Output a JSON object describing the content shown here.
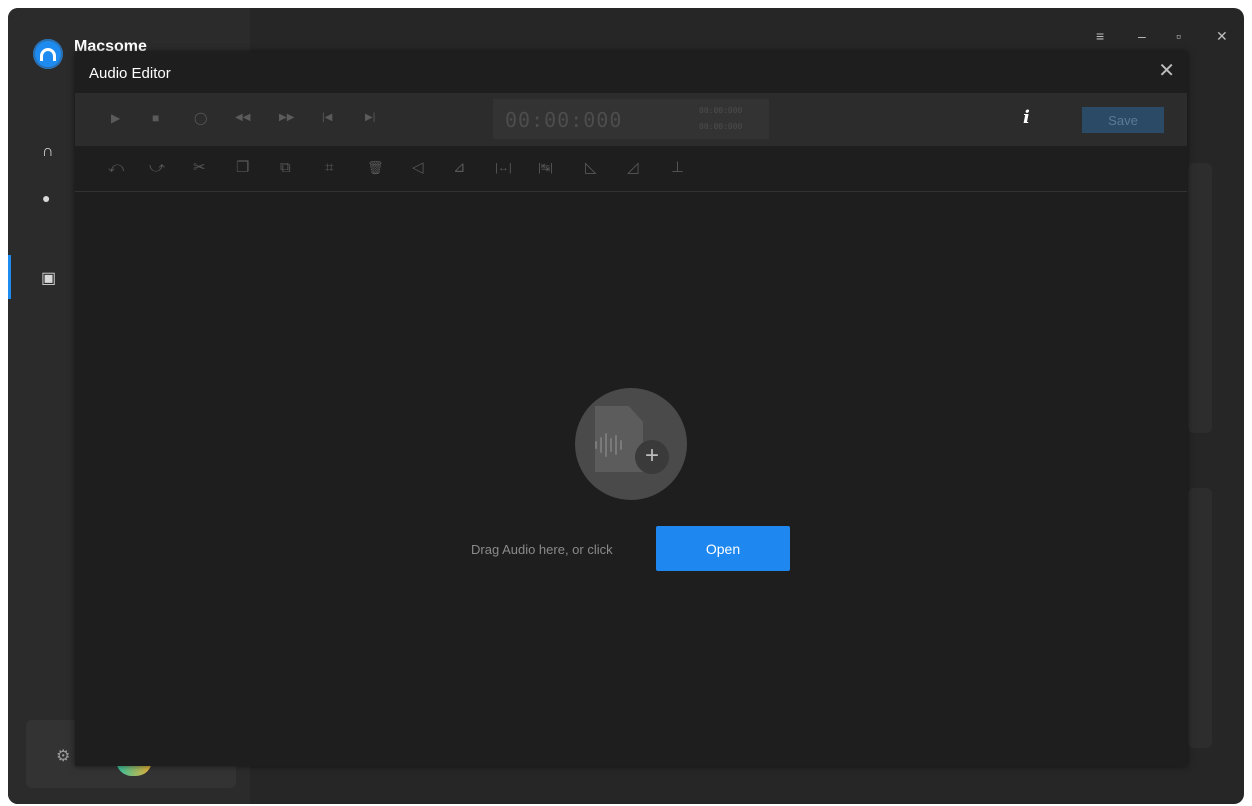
{
  "app": {
    "name": "Macsome"
  },
  "window_controls": {
    "menu_icon": "≡",
    "minimize_icon": "–",
    "maximize_icon": "▫",
    "close_icon": "✕"
  },
  "sidebar": {
    "items": [
      {
        "icon": "headphones-icon",
        "glyph": "∩"
      },
      {
        "icon": "history-icon",
        "glyph": "●"
      },
      {
        "icon": "toolbox-icon",
        "glyph": "▣"
      }
    ],
    "active_item": "toolbox"
  },
  "audio_editor": {
    "title": "Audio Editor",
    "close_glyph": "✕",
    "player": {
      "play": "▶",
      "stop": "■",
      "loop": "◯",
      "rewind": "◀◀",
      "forward": "▶▶",
      "prev": "|◀",
      "next": "▶|",
      "time": "00:00:000",
      "time_start": "00:00:000",
      "time_end": "00:00:000",
      "info": "i",
      "save_label": "Save"
    },
    "edit_tools": {
      "undo": "⤺",
      "redo": "⤻",
      "cut": "✂",
      "copy": "❐",
      "paste": "⧉",
      "crop": "⌗",
      "delete": "🗑",
      "volume": "◁",
      "envelope": "⊿",
      "insert_silence": "|↔|",
      "trim_silence": "|↹|",
      "fade_in": "◺",
      "fade_out": "◿",
      "split": "⊥"
    },
    "drop": {
      "instruction": "Drag Audio here, or click",
      "open_label": "Open",
      "plus": "+"
    }
  },
  "colors": {
    "accent": "#1e88f0",
    "modal_bg": "#1e1e1e",
    "toolbar_bg": "#2c2c2c"
  }
}
